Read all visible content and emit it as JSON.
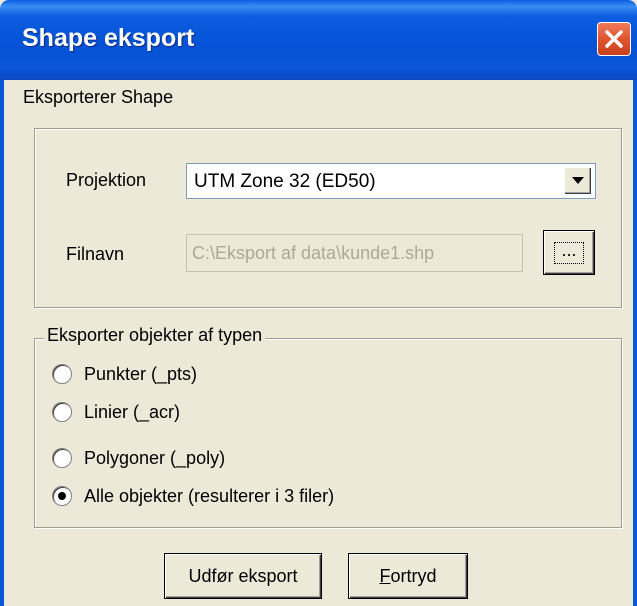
{
  "window": {
    "title": "Shape eksport",
    "subtitle": "Eksporterer Shape"
  },
  "export_panel": {
    "projection_label": "Projektion",
    "projection_value": "UTM Zone 32 (ED50)",
    "filename_label": "Filnavn",
    "filename_value": "C:\\Eksport af data\\kunde1.shp",
    "browse_label": "..."
  },
  "object_types": {
    "legend": "Eksporter objekter af typen",
    "options": [
      {
        "label": "Punkter (_pts)",
        "selected": false
      },
      {
        "label": "Linier (_acr)",
        "selected": false
      },
      {
        "label": "Polygoner (_poly)",
        "selected": false
      },
      {
        "label": "Alle objekter (resulterer i 3 filer)",
        "selected": true
      }
    ]
  },
  "buttons": {
    "export": "Udfør eksport",
    "cancel": "Fortryd"
  },
  "icons": {
    "close": "close-icon",
    "dropdown": "chevron-down-icon"
  }
}
